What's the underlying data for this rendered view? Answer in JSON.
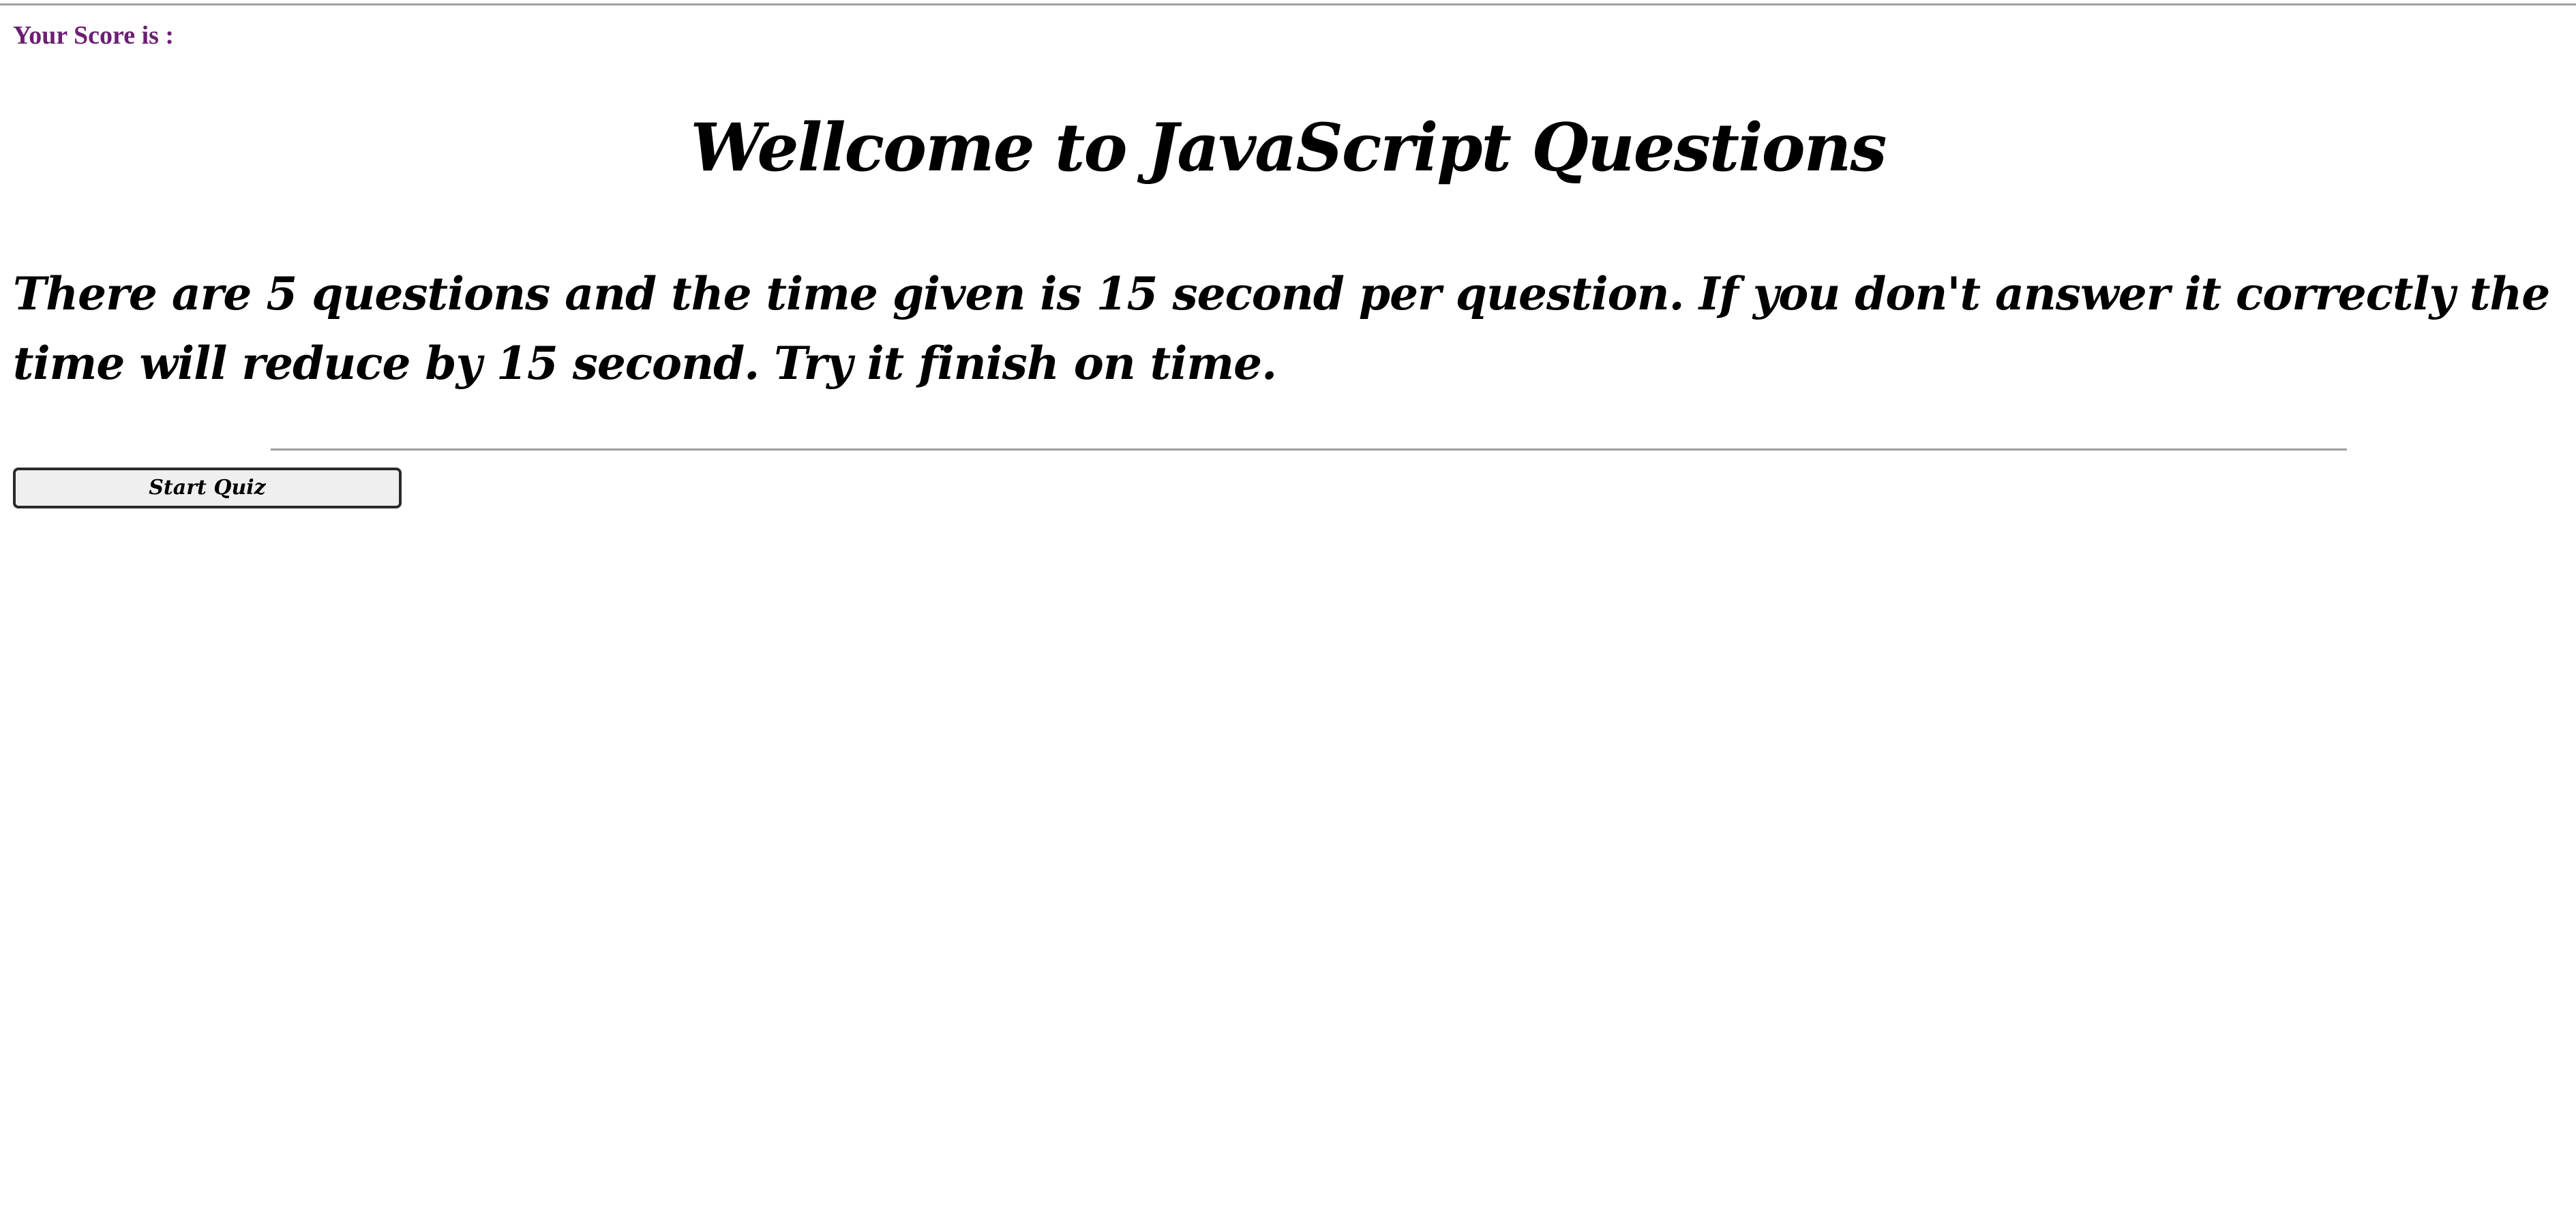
{
  "header": {
    "score_label": "Your Score is :"
  },
  "main": {
    "title": "Wellcome to JavaScript Questions",
    "intro_text": "There are 5 questions and the time given is 15 second per question. If you don't answer it correctly the time will reduce by 15 second. Try it finish on time."
  },
  "actions": {
    "start_label": "Start Quiz"
  },
  "colors": {
    "score_text": "#6b1f73",
    "body_text": "#000000",
    "button_bg": "#efefef",
    "rule": "#9e9e9e"
  }
}
